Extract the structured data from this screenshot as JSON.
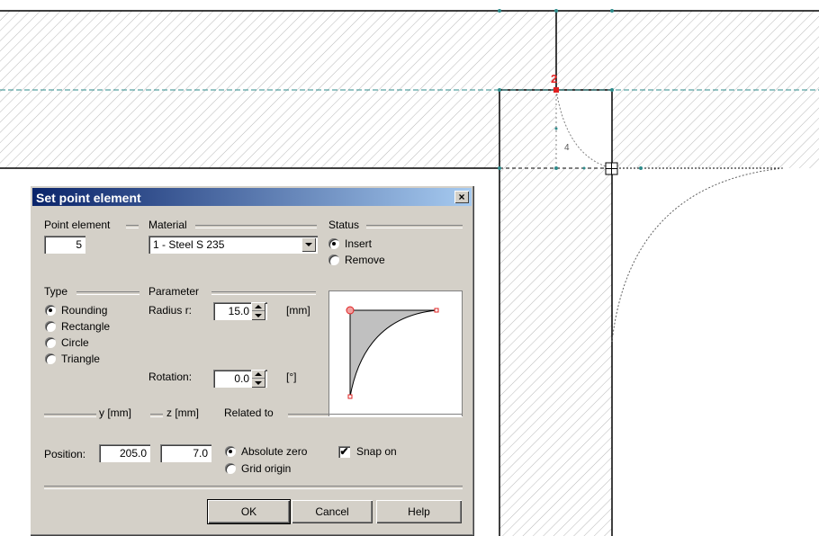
{
  "drawing": {
    "point_label": "2",
    "area_label": "4"
  },
  "dialog": {
    "title": "Set point element",
    "close": "×",
    "point_element": {
      "label": "Point element",
      "value": "5"
    },
    "material": {
      "label": "Material",
      "value": "1 - Steel S 235"
    },
    "status": {
      "label": "Status",
      "options": [
        "Insert",
        "Remove"
      ],
      "selected": "Insert"
    },
    "type": {
      "label": "Type",
      "options": [
        "Rounding",
        "Rectangle",
        "Circle",
        "Triangle"
      ],
      "selected": "Rounding"
    },
    "parameter": {
      "label": "Parameter",
      "radius": {
        "label": "Radius r:",
        "value": "15.0",
        "unit": "[mm]"
      },
      "rotation": {
        "label": "Rotation:",
        "value": "0.0",
        "unit": "[°]"
      }
    },
    "position": {
      "label": "Position:",
      "y_header": "y [mm]",
      "z_header": "z [mm]",
      "y": "205.0",
      "z": "7.0"
    },
    "related_to": {
      "label": "Related to",
      "options": [
        "Absolute zero",
        "Grid origin"
      ],
      "selected": "Absolute zero"
    },
    "snap": {
      "label": "Snap on",
      "checked": true
    },
    "buttons": {
      "ok": "OK",
      "cancel": "Cancel",
      "help": "Help"
    }
  }
}
